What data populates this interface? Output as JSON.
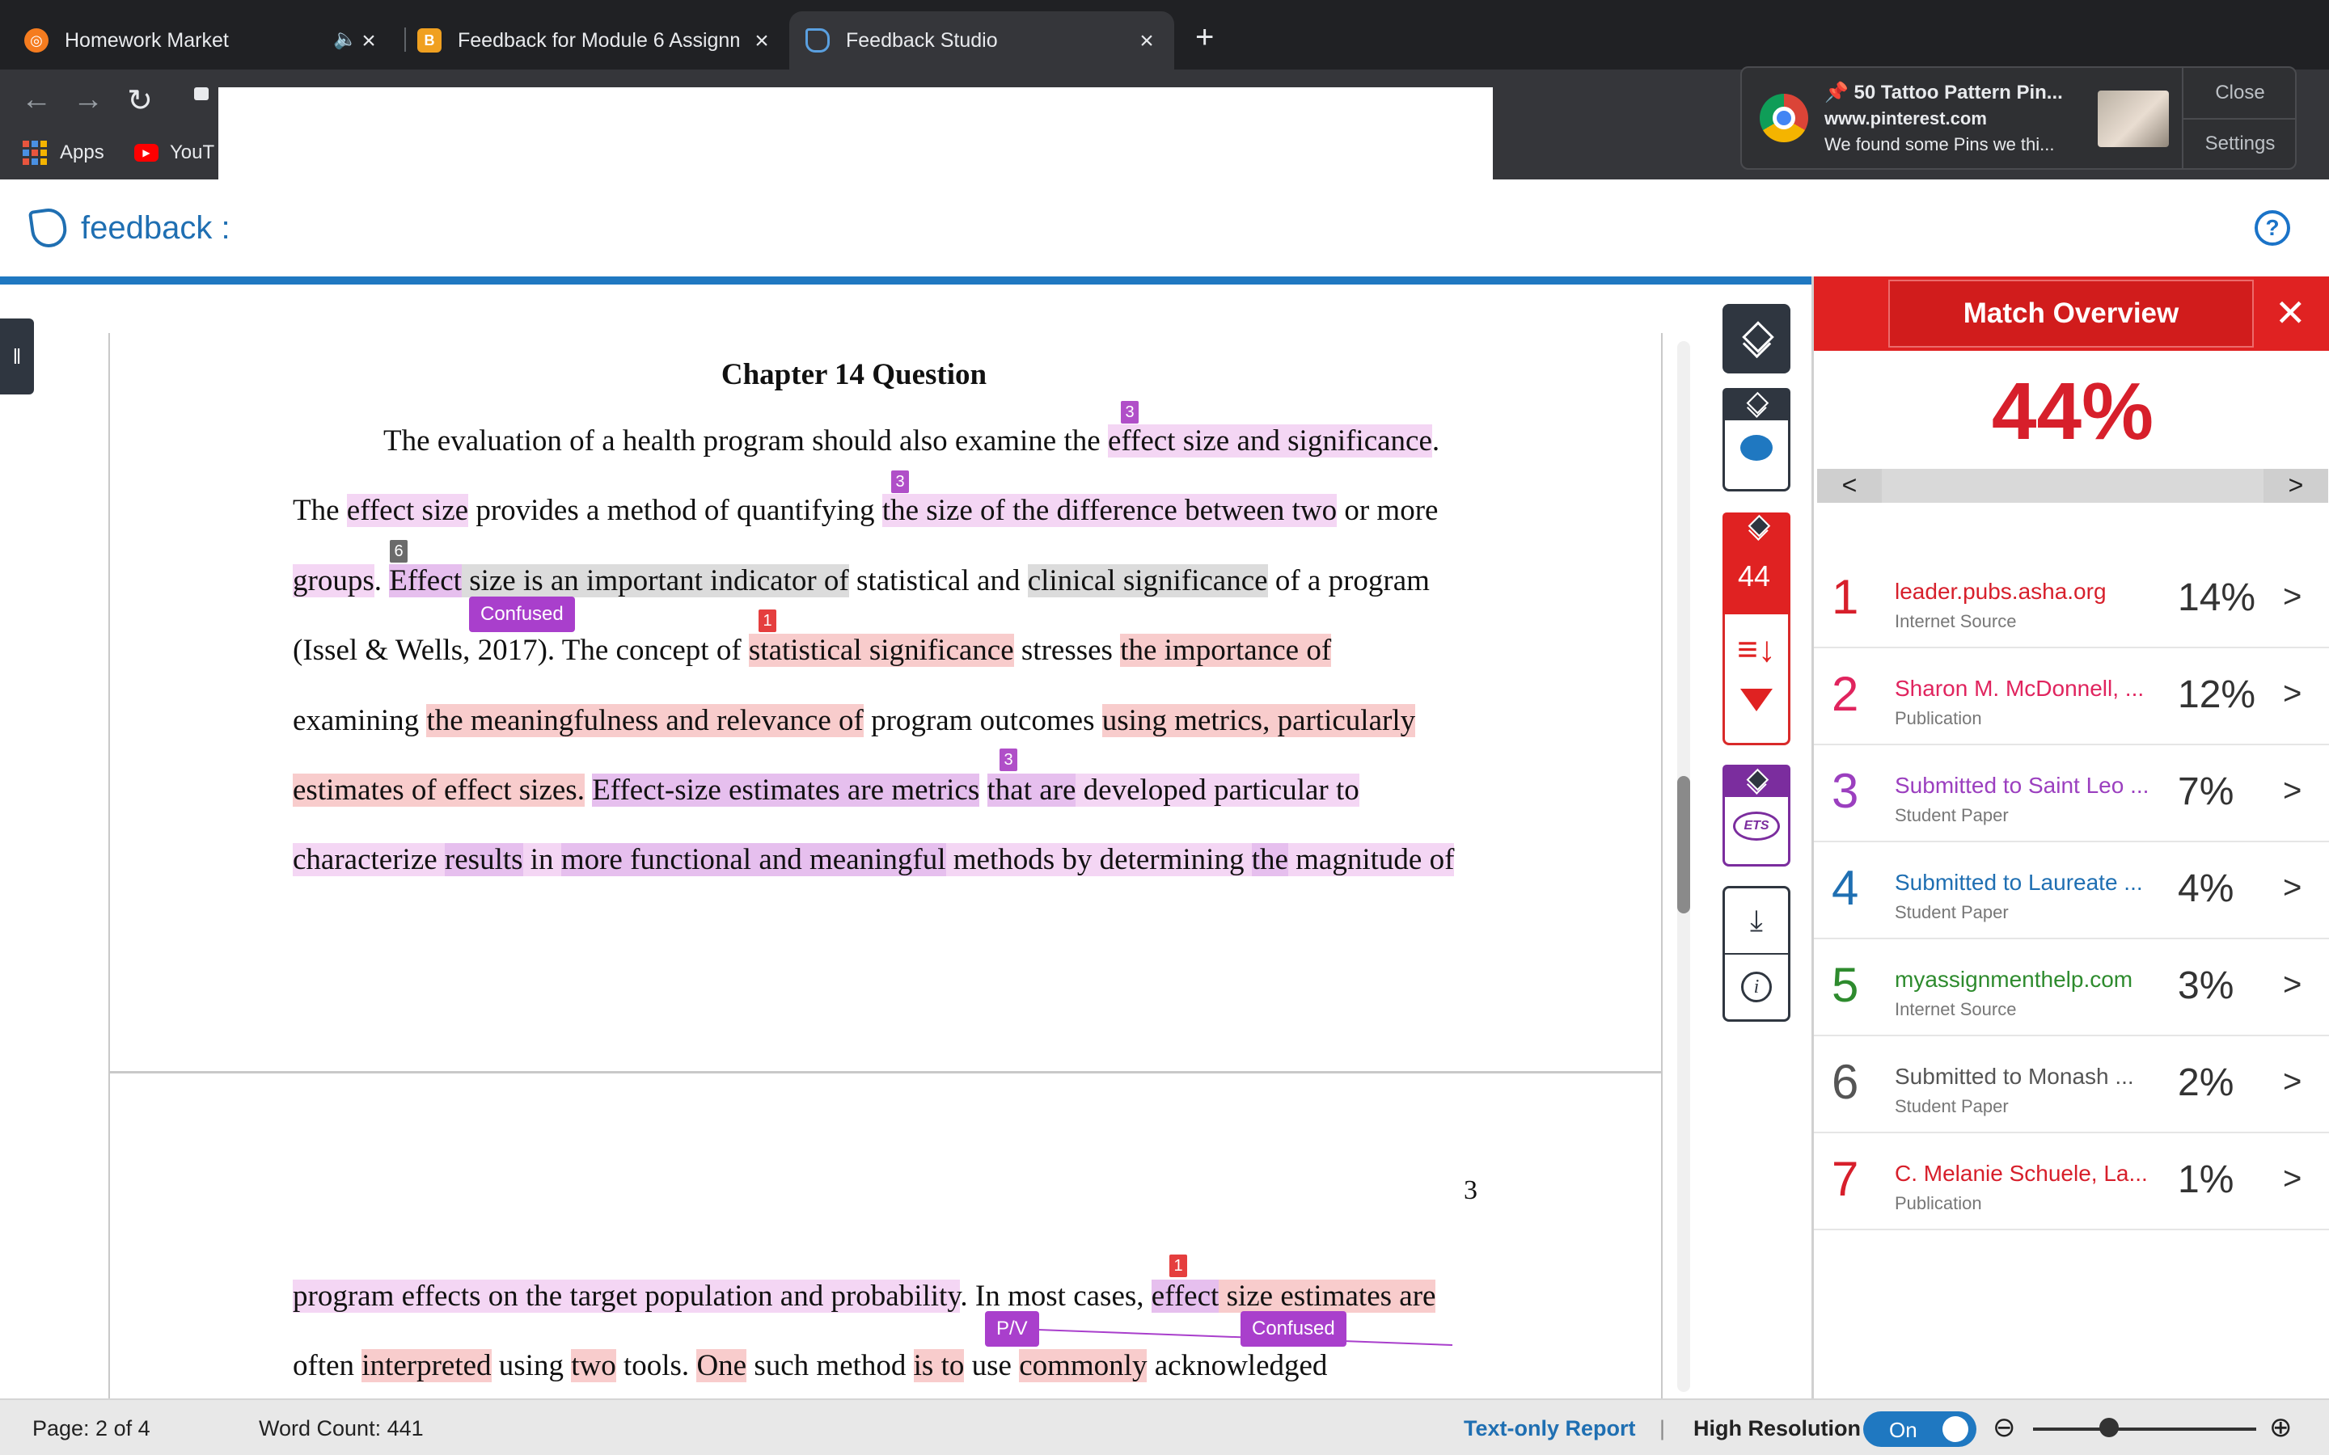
{
  "browser": {
    "tabs": [
      {
        "title": "Homework Market",
        "active": false,
        "audio": true
      },
      {
        "title": "Feedback for Module 6 Assignm",
        "active": false
      },
      {
        "title": "Feedback Studio",
        "active": true
      }
    ],
    "new_tab_glyph": "+",
    "bookmarks": {
      "apps": "Apps",
      "youtube": "YouT"
    }
  },
  "notification": {
    "title": "📌 50 Tattoo Pattern Pin...",
    "site": "www.pinterest.com",
    "body": "We found some Pins we thi...",
    "close_label": "Close",
    "settings_label": "Settings"
  },
  "app": {
    "logo_text": "feedback :",
    "help_glyph": "?"
  },
  "document": {
    "title": "Chapter 14 Question",
    "page_number": "3",
    "lines": {
      "l1a": "The evaluation of a health program should also examine the ",
      "l1b": "effect size and significance",
      "l1c": ".",
      "l2a": "The ",
      "l2b": "effect size",
      "l2c": " provides a method of quantifying ",
      "l2d": "the size of the difference between two",
      "l2e": " or more",
      "l3a": "groups",
      "l3b": ". ",
      "l3c": "Effect",
      "l3d": " size is an important indicator of",
      "l3e": " statistical and ",
      "l3f": "clinical significance",
      "l3g": " of a program",
      "l4a": "(Issel & Wells, 2017). The concept of ",
      "l4b": "statistical significance",
      "l4c": " stresses ",
      "l4d": "the importance of",
      "l5a": "examining ",
      "l5b": "the meaningfulness and relevance of",
      "l5c": " program outcomes ",
      "l5d": "using metrics, particularly",
      "l6a": "estimates of effect sizes.",
      "l6b": " ",
      "l6c": "Effect-size estimates are metrics",
      "l6d": " ",
      "l6e": "that are",
      "l6f": " developed particular to",
      "l7a": "characterize ",
      "l7b": "results",
      "l7c": " in ",
      "l7d": "more functional and meaningful",
      "l7e": " methods by determining ",
      "l7f": "the",
      "l7g": " magnitude of",
      "p2l1a": "program effects on the target population and probability",
      "p2l1b": ". In most cases, ",
      "p2l1c": "effect",
      "p2l1d": " size estimates are",
      "p2l2a": "often ",
      "p2l2b": "interpreted",
      "p2l2c": " using ",
      "p2l2d": "two",
      "p2l2e": " tools. ",
      "p2l2f": "One",
      "p2l2g": " such method ",
      "p2l2h": "is to",
      "p2l2i": " use ",
      "p2l2j": "commonly",
      "p2l2k": " acknowledged"
    },
    "match_tags": {
      "t3a": "3",
      "t3b": "3",
      "t6": "6",
      "t1a": "1",
      "t3c": "3",
      "t1b": "1"
    },
    "quickmarks": {
      "confused1": "Confused",
      "pv": "P/V",
      "confused2": "Confused"
    }
  },
  "tools": {
    "score": "44",
    "ets_label": "ETS"
  },
  "match_overview": {
    "title": "Match Overview",
    "overall": "44%",
    "prev_glyph": "<",
    "next_glyph": ">",
    "sources": [
      {
        "rank": "1",
        "name": "leader.pubs.asha.org",
        "type": "Internet Source",
        "percent": "14%",
        "color": "#d71f2b"
      },
      {
        "rank": "2",
        "name": "Sharon M. McDonnell, ...",
        "type": "Publication",
        "percent": "12%",
        "color": "#e0245e"
      },
      {
        "rank": "3",
        "name": "Submitted to Saint Leo ...",
        "type": "Student Paper",
        "percent": "7%",
        "color": "#9b3fbf"
      },
      {
        "rank": "4",
        "name": "Submitted to Laureate ...",
        "type": "Student Paper",
        "percent": "4%",
        "color": "#1f6fb2"
      },
      {
        "rank": "5",
        "name": "myassignmenthelp.com",
        "type": "Internet Source",
        "percent": "3%",
        "color": "#2e8b2e"
      },
      {
        "rank": "6",
        "name": "Submitted to Monash ...",
        "type": "Student Paper",
        "percent": "2%",
        "color": "#555555"
      },
      {
        "rank": "7",
        "name": "C. Melanie Schuele, La...",
        "type": "Publication",
        "percent": "1%",
        "color": "#d71f2b"
      }
    ]
  },
  "status": {
    "page": "Page: 2 of 4",
    "word_count": "Word Count: 441",
    "text_only": "Text-only Report",
    "separator": "|",
    "high_res": "High Resolution",
    "toggle": "On"
  },
  "colors": {
    "accent": "#1f78c1",
    "match_red": "#e02222"
  }
}
